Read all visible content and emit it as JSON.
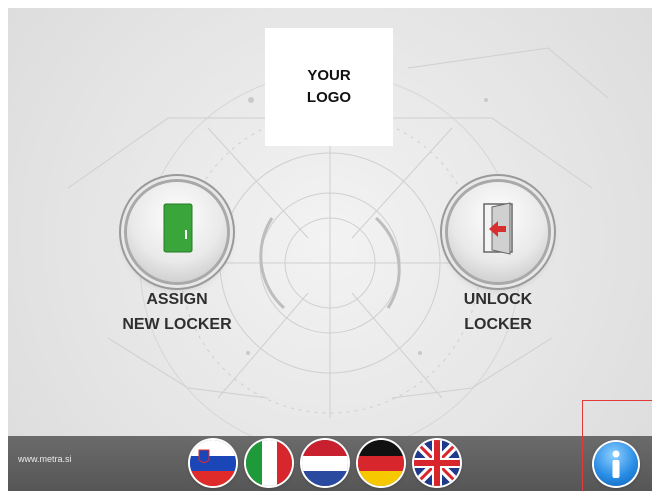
{
  "logo": {
    "text": "YOUR\nLOGO"
  },
  "actions": {
    "assign": {
      "label": "ASSIGN\nNEW LOCKER",
      "icon": "green-locker-door-icon"
    },
    "unlock": {
      "label": "UNLOCK\nLOCKER",
      "icon": "door-exit-arrow-icon"
    }
  },
  "footer": {
    "website": "www.metra.si",
    "languages": [
      {
        "code": "sl",
        "icon": "slovenia-flag-icon"
      },
      {
        "code": "it",
        "icon": "italy-flag-icon"
      },
      {
        "code": "nl",
        "icon": "netherlands-flag-icon"
      },
      {
        "code": "de",
        "icon": "germany-flag-icon"
      },
      {
        "code": "en",
        "icon": "uk-flag-icon"
      }
    ],
    "info_icon": "info-icon"
  },
  "colors": {
    "bar": "#5f5f5f",
    "accent_green": "#3aa53a",
    "arrow_red": "#d83030",
    "info_blue": "#2a8ee6",
    "selection_outline": "#e23a3a"
  }
}
